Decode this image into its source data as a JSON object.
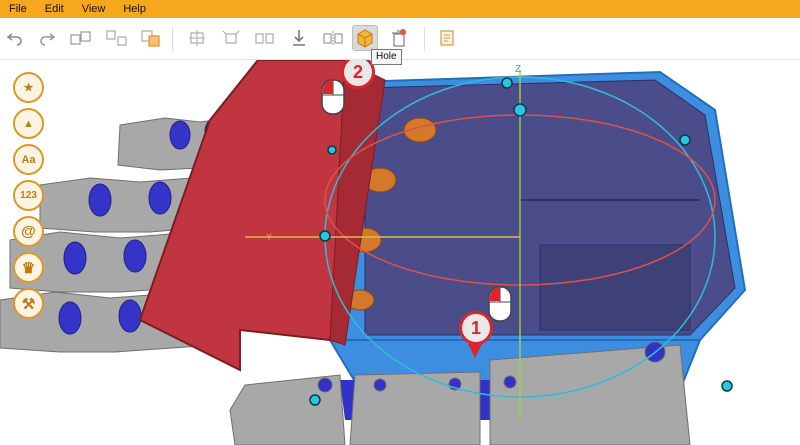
{
  "menu": [
    "File",
    "Edit",
    "View",
    "Help"
  ],
  "toolbar": {
    "buttons": [
      {
        "name": "undo-button",
        "icon": "undo-icon"
      },
      {
        "name": "redo-button",
        "icon": "redo-icon"
      },
      {
        "name": "group-button",
        "icon": "group-icon"
      },
      {
        "name": "ungroup-button",
        "icon": "ungroup-icon"
      },
      {
        "name": "merge-button",
        "icon": "merge-icon"
      },
      {
        "name": "align-button",
        "icon": "align-icon"
      },
      {
        "name": "distribute-button",
        "icon": "distribute-icon"
      },
      {
        "name": "duplicate-button",
        "icon": "duplicate-icon"
      },
      {
        "name": "drop-to-floor-button",
        "icon": "drop-icon"
      },
      {
        "name": "mirror-button",
        "icon": "mirror-icon"
      },
      {
        "name": "hole-button",
        "icon": "hole-icon"
      },
      {
        "name": "delete-button",
        "icon": "delete-icon"
      },
      {
        "name": "notes-button",
        "icon": "notes-icon"
      }
    ],
    "tooltip": "Hole"
  },
  "sidebar": {
    "items": [
      {
        "name": "favorites",
        "icon": "star-icon",
        "label": "★"
      },
      {
        "name": "shapes",
        "icon": "pyramid-icon",
        "label": "▲"
      },
      {
        "name": "text",
        "icon": "text-icon",
        "label": "Aa"
      },
      {
        "name": "numbers",
        "icon": "numbers-icon",
        "label": "123"
      },
      {
        "name": "symbols",
        "icon": "at-icon",
        "label": "@"
      },
      {
        "name": "premium",
        "icon": "crown-icon",
        "label": "♛"
      },
      {
        "name": "tools",
        "icon": "tools-icon",
        "label": "⚒"
      }
    ]
  },
  "viewport": {
    "axis_labels": {
      "z": "Z",
      "y": "Y"
    },
    "steps": [
      {
        "label": "1"
      },
      {
        "label": "2"
      }
    ]
  },
  "colors": {
    "menubar": "#f6a81c",
    "accent": "#d9262c",
    "box_outer": "#3d8ee0",
    "box_inner": "#4b4d8a",
    "red_block": "#c0353f",
    "gray_part": "#a8a8a8",
    "blue_pin": "#3232c8",
    "gizmo_cyan": "#30bcd8",
    "gizmo_red": "#e0504a"
  }
}
